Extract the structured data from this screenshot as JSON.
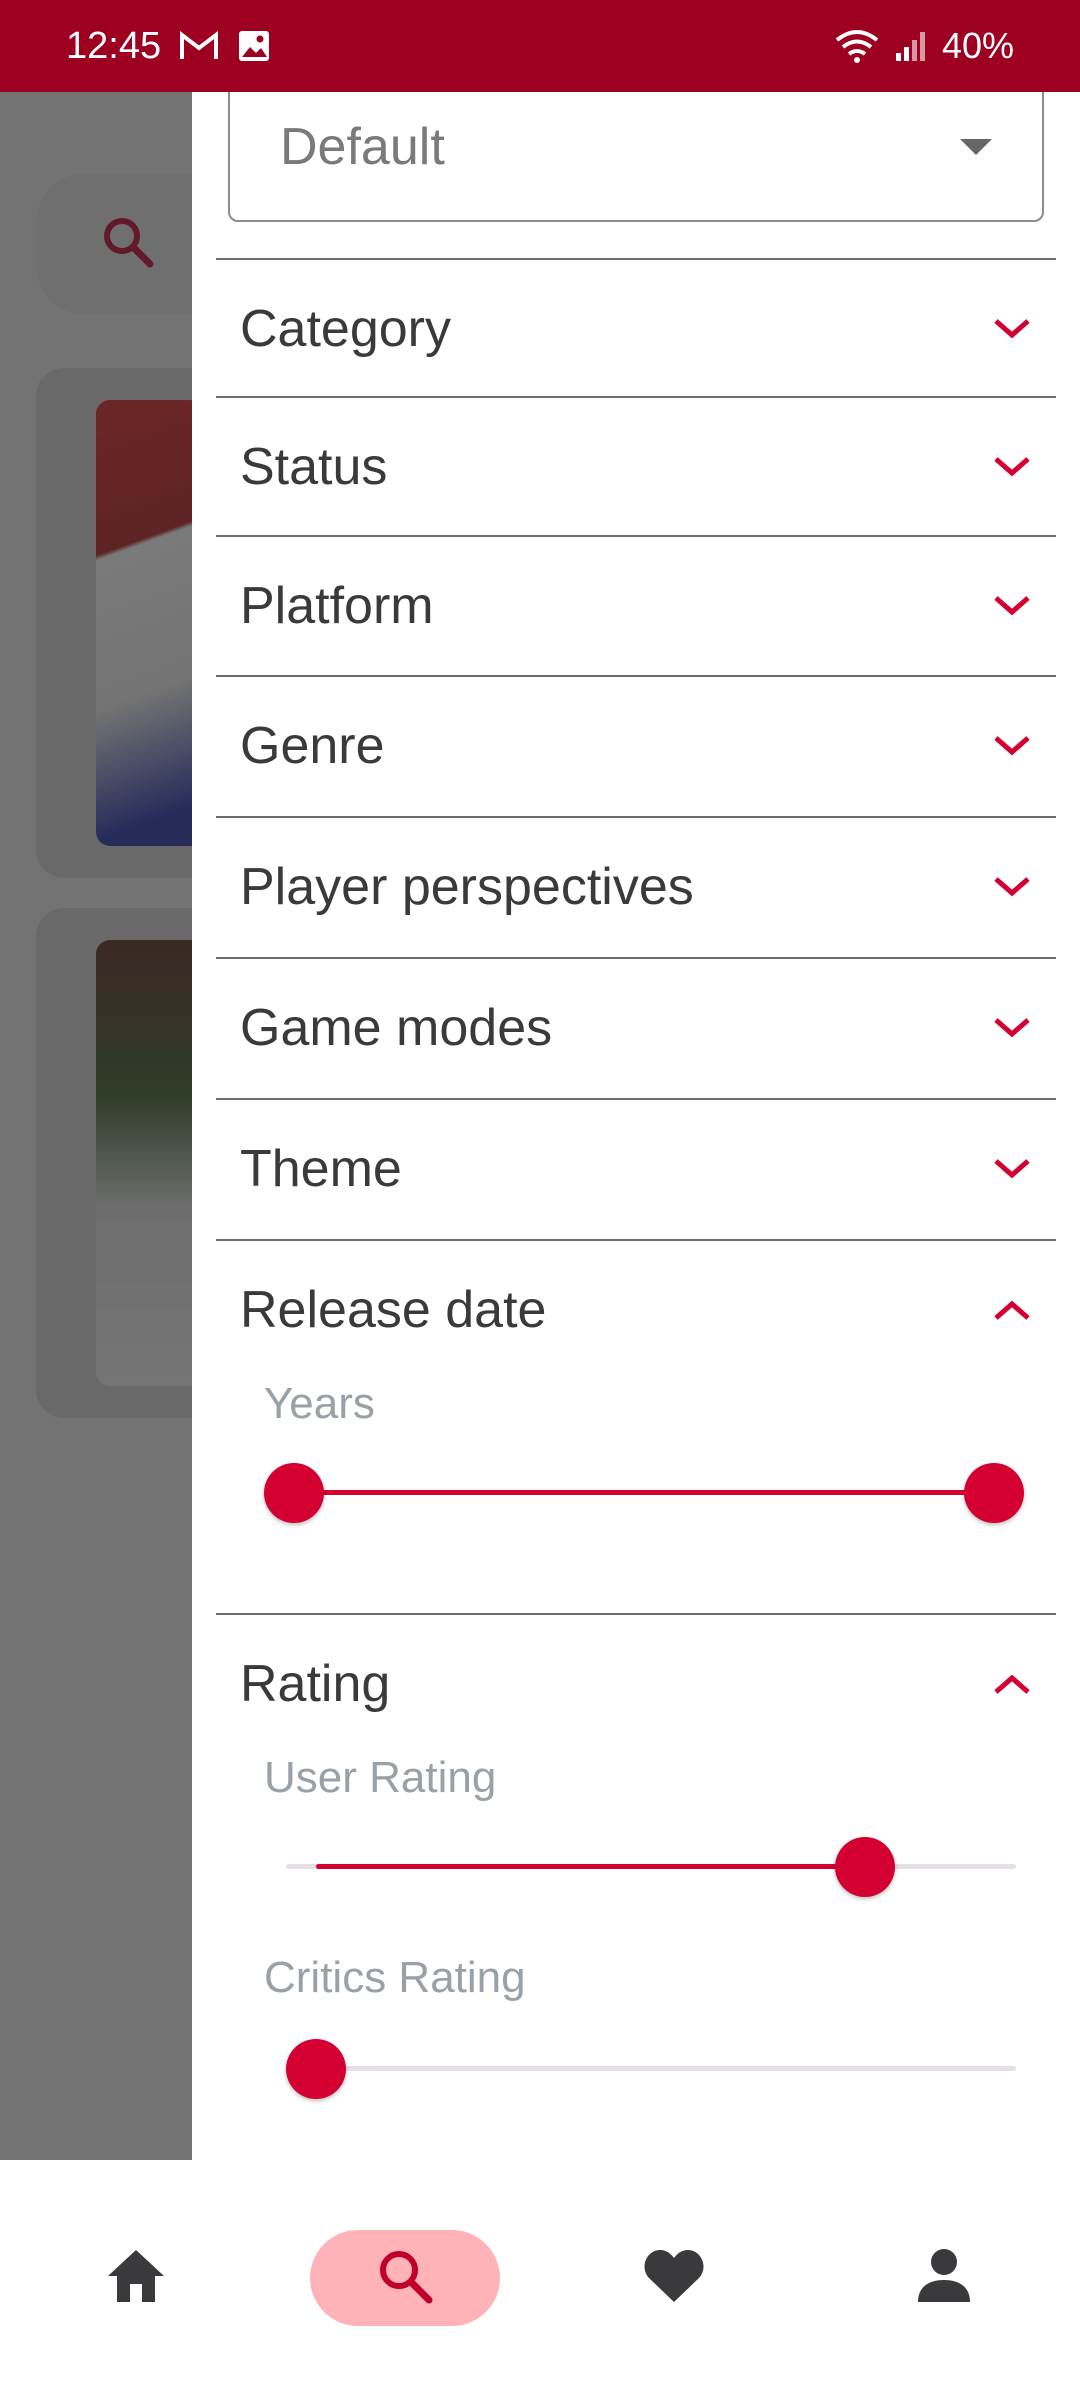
{
  "status_bar": {
    "time": "12:45",
    "battery": "40%",
    "icons": [
      "gmail-icon",
      "image-icon",
      "wifi-icon",
      "signal-icon"
    ]
  },
  "drawer": {
    "sort": {
      "value": "Default"
    },
    "sections": [
      {
        "title": "Category",
        "expanded": false
      },
      {
        "title": "Status",
        "expanded": false
      },
      {
        "title": "Platform",
        "expanded": false
      },
      {
        "title": "Genre",
        "expanded": false
      },
      {
        "title": "Player perspectives",
        "expanded": false
      },
      {
        "title": "Game modes",
        "expanded": false
      },
      {
        "title": "Theme",
        "expanded": false
      },
      {
        "title": "Release date",
        "expanded": true
      },
      {
        "title": "Rating",
        "expanded": true
      }
    ],
    "release_date": {
      "label": "Years",
      "range_start": 0.0,
      "range_end": 1.0
    },
    "rating": {
      "user_label": "User Rating",
      "user_value": 0.82,
      "critics_label": "Critics Rating",
      "critics_value": 0.0
    }
  },
  "bottom_nav": {
    "items": [
      {
        "name": "home",
        "icon": "home-icon",
        "active": false
      },
      {
        "name": "search",
        "icon": "search-icon",
        "active": true
      },
      {
        "name": "favorites",
        "icon": "heart-icon",
        "active": false
      },
      {
        "name": "profile",
        "icon": "person-icon",
        "active": false
      }
    ]
  },
  "colors": {
    "accent": "#d50032",
    "status_bar": "#9d0020",
    "nav_active_bg": "#ffb3b8"
  }
}
